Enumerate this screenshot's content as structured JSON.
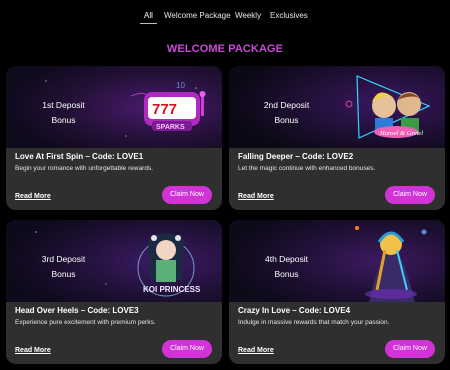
{
  "tabs": [
    {
      "label": "All",
      "active": true
    },
    {
      "label": "Welcome Package",
      "active": false
    },
    {
      "label": "Weekly",
      "active": false
    },
    {
      "label": "Exclusives",
      "active": false
    }
  ],
  "section_title": "WELCOME PACKAGE",
  "cards": [
    {
      "deposit_line1": "1st Deposit",
      "deposit_line2": "Bonus",
      "image_label": "SPARKS",
      "title": "Love At First Spin – Code: LOVE1",
      "desc": "Begin your romance with unforgettable rewards.",
      "read_more": "Read More",
      "claim": "Claim Now"
    },
    {
      "deposit_line1": "2nd Deposit",
      "deposit_line2": "Bonus",
      "image_label": "Hansel & Gretel",
      "title": "Falling Deeper – Code: LOVE2",
      "desc": "Let the magic continue with enhanced bonuses.",
      "read_more": "Read More",
      "claim": "Claim Now"
    },
    {
      "deposit_line1": "3rd Deposit",
      "deposit_line2": "Bonus",
      "image_label": "KOI PRINCESS",
      "title": "Head Over Heels – Code: LOVE3",
      "desc": "Experience pure excitement with premium perks.",
      "read_more": "Read More",
      "claim": "Claim Now"
    },
    {
      "deposit_line1": "4th Deposit",
      "deposit_line2": "Bonus",
      "image_label": "",
      "title": "Crazy In Love – Code: LOVE4",
      "desc": "Indulge in massive rewards that match your passion.",
      "read_more": "Read More",
      "claim": "Claim Now"
    }
  ],
  "colors": {
    "accent": "#d233d8",
    "title_purple": "#c94ad6",
    "card_bg": "#2f2f2f",
    "page_bg": "#000000"
  }
}
